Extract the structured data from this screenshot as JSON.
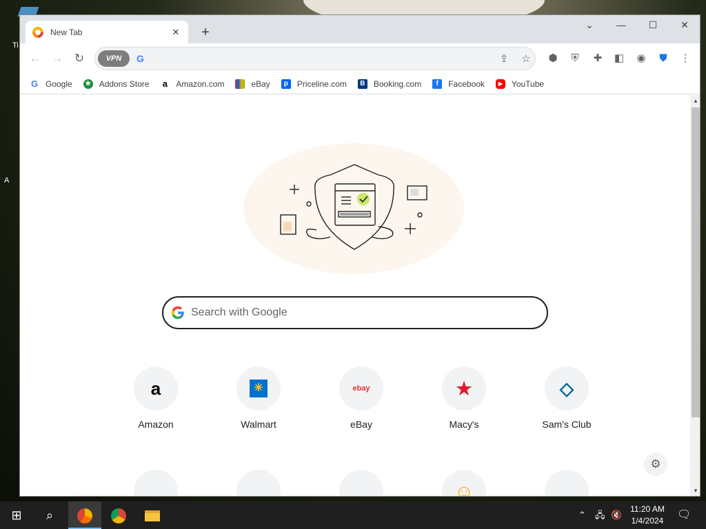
{
  "desktop": {
    "partial_label_1": "Ti",
    "partial_label_2": "A"
  },
  "browser": {
    "tab": {
      "title": "New Tab"
    },
    "omnibox": {
      "vpn_label": "VPN",
      "value": ""
    },
    "bookmarks": [
      {
        "label": "Google",
        "icon": "google-g-icon",
        "color": "#4285f4"
      },
      {
        "label": "Addons Store",
        "icon": "addons-store-icon",
        "color": "#1e8e3e"
      },
      {
        "label": "Amazon.com",
        "icon": "amazon-a-icon",
        "color": "#000000"
      },
      {
        "label": "eBay",
        "icon": "ebay-bag-icon",
        "color": "#e53238"
      },
      {
        "label": "Priceline.com",
        "icon": "priceline-p-icon",
        "color": "#0068ef"
      },
      {
        "label": "Booking.com",
        "icon": "booking-b-icon",
        "color": "#003580"
      },
      {
        "label": "Facebook",
        "icon": "facebook-f-icon",
        "color": "#1877f2"
      },
      {
        "label": "YouTube",
        "icon": "youtube-play-icon",
        "color": "#ff0000"
      }
    ]
  },
  "newtab": {
    "search_placeholder": "Search with Google",
    "shortcuts": [
      {
        "label": "Amazon",
        "glyph": "a",
        "color": "#000000"
      },
      {
        "label": "Walmart",
        "glyph": "✳",
        "color": "#0071ce"
      },
      {
        "label": "eBay",
        "glyph": "ebay",
        "color": "#e53238"
      },
      {
        "label": "Macy's",
        "glyph": "★",
        "color": "#e21a2c"
      },
      {
        "label": "Sam's Club",
        "glyph": "◇",
        "color": "#0067a0"
      }
    ]
  },
  "taskbar": {
    "time": "11:20 AM",
    "date": "1/4/2024"
  }
}
